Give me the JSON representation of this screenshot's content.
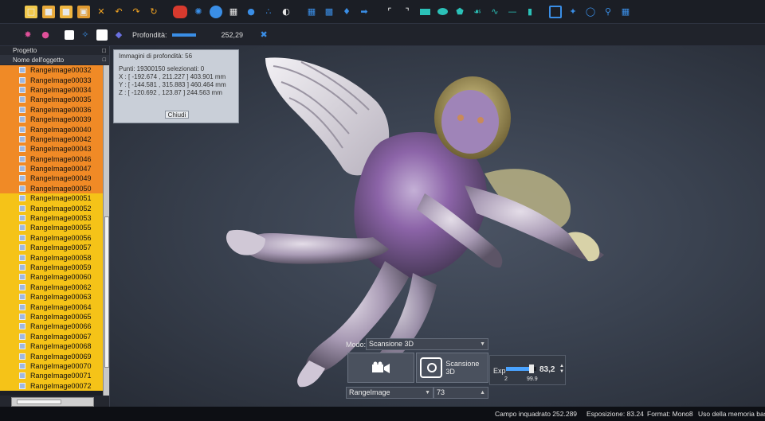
{
  "colors": {
    "row_orange": "#f08a26",
    "row_yellow": "#f5c318",
    "toolbar_bg": "#1b1e25",
    "viewport_bg": "#3a4250"
  },
  "toolbar1": {
    "icons": [
      "new-file-icon",
      "open-folder-icon",
      "open-file-icon",
      "save-icon",
      "cut-icon",
      "undo-icon",
      "redo-icon",
      "refresh-icon",
      "scanner-icon",
      "align-icon",
      "globe-icon",
      "mesh-icon",
      "merge-icon",
      "points-icon",
      "fill-icon",
      "grid-small-icon",
      "grid-large-icon",
      "feet-icon",
      "arrow-icon",
      "curve-icon",
      "curve-corner-icon",
      "rectangle-icon",
      "ellipse-icon",
      "polygon-icon",
      "lasso-icon",
      "freehand-icon",
      "line-icon",
      "panel-icon",
      "window-icon",
      "compass-icon",
      "plane-icon",
      "search-icon",
      "cursor-icon"
    ]
  },
  "toolbar2": {
    "depth_label": "Profondità:",
    "depth_value": "252,29",
    "icons": [
      "light-icon",
      "color-balls-icon",
      "color-picker-icon",
      "magic-wand-icon",
      "white-square-icon",
      "shield-icon",
      "tools-icon"
    ]
  },
  "project_panel": {
    "title": "Progetto",
    "column": "Nome dell'oggetto",
    "items": [
      {
        "label": "RangeImage00032",
        "state": "selected"
      },
      {
        "label": "RangeImage00033",
        "state": "selected"
      },
      {
        "label": "RangeImage00034",
        "state": "selected"
      },
      {
        "label": "RangeImage00035",
        "state": "selected"
      },
      {
        "label": "RangeImage00036",
        "state": "selected"
      },
      {
        "label": "RangeImage00039",
        "state": "selected"
      },
      {
        "label": "RangeImage00040",
        "state": "selected"
      },
      {
        "label": "RangeImage00042",
        "state": "selected"
      },
      {
        "label": "RangeImage00043",
        "state": "selected"
      },
      {
        "label": "RangeImage00046",
        "state": "selected"
      },
      {
        "label": "RangeImage00047",
        "state": "selected"
      },
      {
        "label": "RangeImage00049",
        "state": "selected"
      },
      {
        "label": "RangeImage00050",
        "state": "selected"
      },
      {
        "label": "RangeImage00051",
        "state": "normal"
      },
      {
        "label": "RangeImage00052",
        "state": "normal"
      },
      {
        "label": "RangeImage00053",
        "state": "normal"
      },
      {
        "label": "RangeImage00055",
        "state": "normal"
      },
      {
        "label": "RangeImage00056",
        "state": "normal"
      },
      {
        "label": "RangeImage00057",
        "state": "normal"
      },
      {
        "label": "RangeImage00058",
        "state": "normal"
      },
      {
        "label": "RangeImage00059",
        "state": "normal"
      },
      {
        "label": "RangeImage00060",
        "state": "normal"
      },
      {
        "label": "RangeImage00062",
        "state": "normal"
      },
      {
        "label": "RangeImage00063",
        "state": "normal"
      },
      {
        "label": "RangeImage00064",
        "state": "normal"
      },
      {
        "label": "RangeImage00065",
        "state": "normal"
      },
      {
        "label": "RangeImage00066",
        "state": "normal"
      },
      {
        "label": "RangeImage00067",
        "state": "normal"
      },
      {
        "label": "RangeImage00068",
        "state": "normal"
      },
      {
        "label": "RangeImage00069",
        "state": "normal"
      },
      {
        "label": "RangeImage00070",
        "state": "normal"
      },
      {
        "label": "RangeImage00071",
        "state": "normal"
      },
      {
        "label": "RangeImage00072",
        "state": "normal"
      }
    ]
  },
  "info_panel": {
    "depth_images": "Immagini di profondità: 56",
    "points": "Punti:      19300150  selezionati: 0",
    "x": "X :   [ -192.674 , 211.227 ]  403.901 mm",
    "y": "Y :   [ -144.581 , 315.883 ]  460.464 mm",
    "z": "Z :   [ -120.692 , 123.87 ]   244.563 mm",
    "close": "Chiudi"
  },
  "scan": {
    "mode_label": "Modo:",
    "mode_value": "Scansione 3D",
    "scan_button": "Scansione 3D",
    "range_select": "RangeImage",
    "range_number": "73",
    "exp_label": "Exp",
    "exp_value": "83,2",
    "exp_fraction": 0.84,
    "exp_min": "2",
    "exp_max": "99.9"
  },
  "status": {
    "field": "Campo inquadrato 252.289",
    "exposure": "Esposizione: 83.24",
    "format": "Format: Mono8",
    "memory": "Uso della memoria bass"
  }
}
